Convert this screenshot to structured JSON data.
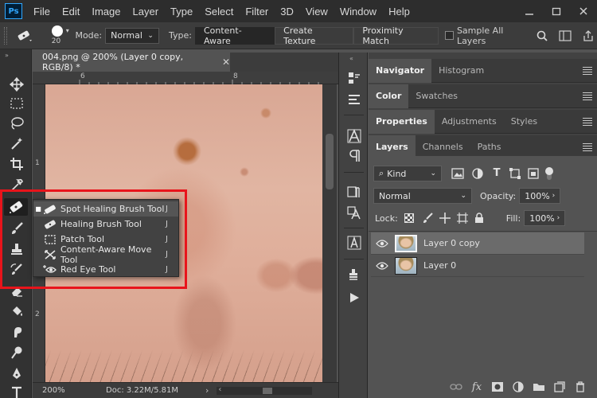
{
  "menubar": {
    "logo": "Ps",
    "items": [
      "File",
      "Edit",
      "Image",
      "Layer",
      "Type",
      "Select",
      "Filter",
      "3D",
      "View",
      "Window",
      "Help"
    ]
  },
  "options": {
    "brush_size": "20",
    "mode_label": "Mode:",
    "mode_value": "Normal",
    "type_label": "Type:",
    "type_buttons": [
      "Content-Aware",
      "Create Texture",
      "Proximity Match"
    ],
    "sample_all_layers": "Sample All Layers"
  },
  "document": {
    "tab_title": "004.png @ 200% (Layer 0 copy, RGB/8) *",
    "ruler_top": [
      "6",
      "8"
    ],
    "ruler_left": [
      "1",
      "2"
    ],
    "zoom": "200%",
    "doc_info": "Doc: 3.22M/5.81M"
  },
  "flyout": {
    "items": [
      {
        "label": "Spot Healing Brush Tool",
        "key": "J",
        "current": true
      },
      {
        "label": "Healing Brush Tool",
        "key": "J",
        "current": false
      },
      {
        "label": "Patch Tool",
        "key": "J",
        "current": false
      },
      {
        "label": "Content-Aware Move Tool",
        "key": "J",
        "current": false
      },
      {
        "label": "Red Eye Tool",
        "key": "J",
        "current": false
      }
    ]
  },
  "panels": {
    "group1": [
      "Navigator",
      "Histogram"
    ],
    "group2": [
      "Color",
      "Swatches"
    ],
    "group3": [
      "Properties",
      "Adjustments",
      "Styles"
    ],
    "group4": [
      "Layers",
      "Channels",
      "Paths"
    ],
    "kind_filter": "Kind",
    "blend_mode": "Normal",
    "opacity_label": "Opacity:",
    "opacity_value": "100%",
    "lock_label": "Lock:",
    "fill_label": "Fill:",
    "fill_value": "100%",
    "layers": [
      {
        "name": "Layer 0 copy",
        "selected": true
      },
      {
        "name": "Layer 0",
        "selected": false
      }
    ]
  },
  "colors": {
    "highlight_red": "#e8141b",
    "ps_blue": "#31a8ff"
  }
}
